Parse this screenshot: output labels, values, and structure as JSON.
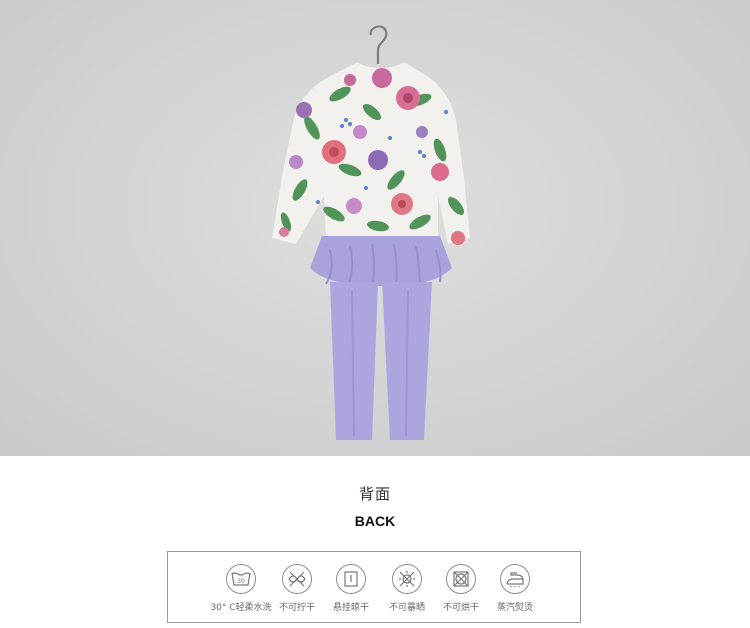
{
  "caption": {
    "cn": "背面",
    "en": "BACK"
  },
  "care_items": [
    {
      "icon": "wash-30-icon",
      "label": "30° C轻柔水洗"
    },
    {
      "icon": "no-wring-icon",
      "label": "不可拧干"
    },
    {
      "icon": "hang-dry-icon",
      "label": "悬挂晾干"
    },
    {
      "icon": "no-sun-dry-icon",
      "label": "不可暴晒"
    },
    {
      "icon": "no-tumble-dry-icon",
      "label": "不可烘干"
    },
    {
      "icon": "steam-iron-icon",
      "label": "蒸汽熨烫"
    }
  ],
  "colors": {
    "background": "#d3d3d3",
    "pants": "#a9a5dc",
    "flower_pink": "#d9637c",
    "flower_purple": "#9b6fb4",
    "leaf": "#3f8a4a"
  }
}
